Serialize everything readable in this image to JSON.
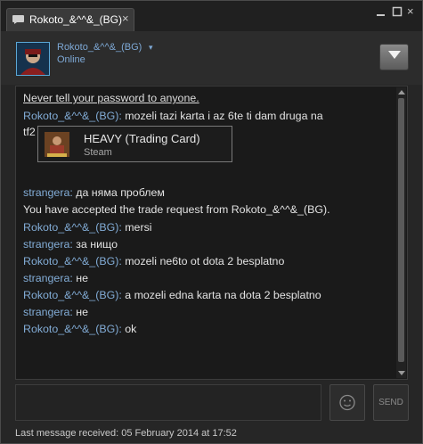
{
  "window": {
    "tab_title": "Rokoto_&^^&_(BG)",
    "tab_close": "×",
    "close_glyph": "×",
    "icons": [
      "chat-bubble-icon",
      "minimize-icon",
      "maximize-icon",
      "close-icon"
    ]
  },
  "header": {
    "friend_name": "Rokoto_&^^&_(BG)",
    "friend_caret": "▾",
    "status": "Online",
    "accent": "#7ea9d6"
  },
  "chat": {
    "system_notice": "Never tell your password to anyone.",
    "messages": [
      {
        "nick": "Rokoto_&^^&_(BG):",
        "text": " mozeli tazi karta i az 6te ti dam druga na"
      },
      {
        "nick": "",
        "text": "tf2"
      },
      {
        "nick": "strangera:",
        "text": " да няма проблем"
      },
      {
        "nick": "",
        "text": "You have accepted the trade request from Rokoto_&^^&_(BG)."
      },
      {
        "nick": "Rokoto_&^^&_(BG):",
        "text": " mersi"
      },
      {
        "nick": "strangera:",
        "text": " за нищо"
      },
      {
        "nick": "Rokoto_&^^&_(BG):",
        "text": " mozeli ne6to ot dota 2 besplatno"
      },
      {
        "nick": "strangera:",
        "text": " не"
      },
      {
        "nick": "Rokoto_&^^&_(BG):",
        "text": " a mozeli edna karta na dota 2 besplatno"
      },
      {
        "nick": "strangera:",
        "text": " не"
      },
      {
        "nick": "Rokoto_&^^&_(BG):",
        "text": " ok"
      }
    ],
    "item_card": {
      "title": "HEAVY (Trading Card)",
      "subtitle": "Steam"
    }
  },
  "input": {
    "value": "",
    "send_label": "SEND"
  },
  "footer": {
    "last_message": "Last message received: 05 February 2014 at 17:52"
  },
  "colors": {
    "background": "#262626",
    "chat_background": "#1a1a1a",
    "nick": "#82acd6",
    "text": "#e2e2e2"
  }
}
